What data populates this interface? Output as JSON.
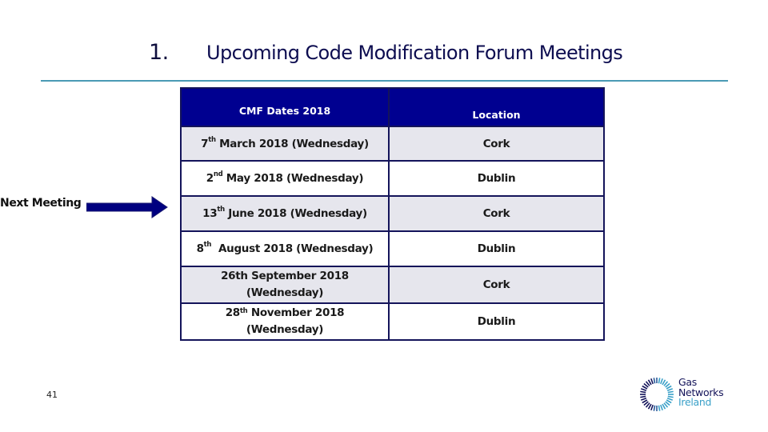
{
  "slide": {
    "number_prefix": "1.",
    "title": "Upcoming Code Modification Forum Meetings",
    "page_number": "41"
  },
  "colors": {
    "header_bg": "#000090",
    "divider": "#4a9ab5",
    "row_shade": "#e6e6ed",
    "border": "#14145a",
    "arrow": "#000080"
  },
  "next_meeting": {
    "label": "Next Meeting",
    "arrow_icon": "right-arrow-icon",
    "points_to_row": 2
  },
  "table": {
    "headers": [
      "CMF Dates 2018",
      "Location"
    ],
    "rows": [
      {
        "day": "7",
        "suffix": "th",
        "rest": " March 2018 (Wednesday)",
        "location": "Cork"
      },
      {
        "day": "2",
        "suffix": "nd",
        "rest": " May 2018 (Wednesday)",
        "location": "Dublin"
      },
      {
        "day": "13",
        "suffix": "th",
        "rest": " June 2018 (Wednesday)",
        "location": "Cork"
      },
      {
        "day": "8",
        "suffix": "th",
        "rest": "  August 2018 (Wednesday)",
        "location": "Dublin"
      },
      {
        "line1": "26th September 2018",
        "line2": "(Wednesday)",
        "location": "Cork"
      },
      {
        "day": "28",
        "suffix": "th",
        "rest": " November 2018",
        "line2": "(Wednesday)",
        "location": "Dublin"
      }
    ]
  },
  "logo": {
    "icon": "gas-networks-ring-icon",
    "line1": "Gas",
    "line2": "Networks",
    "line3": "Ireland"
  }
}
